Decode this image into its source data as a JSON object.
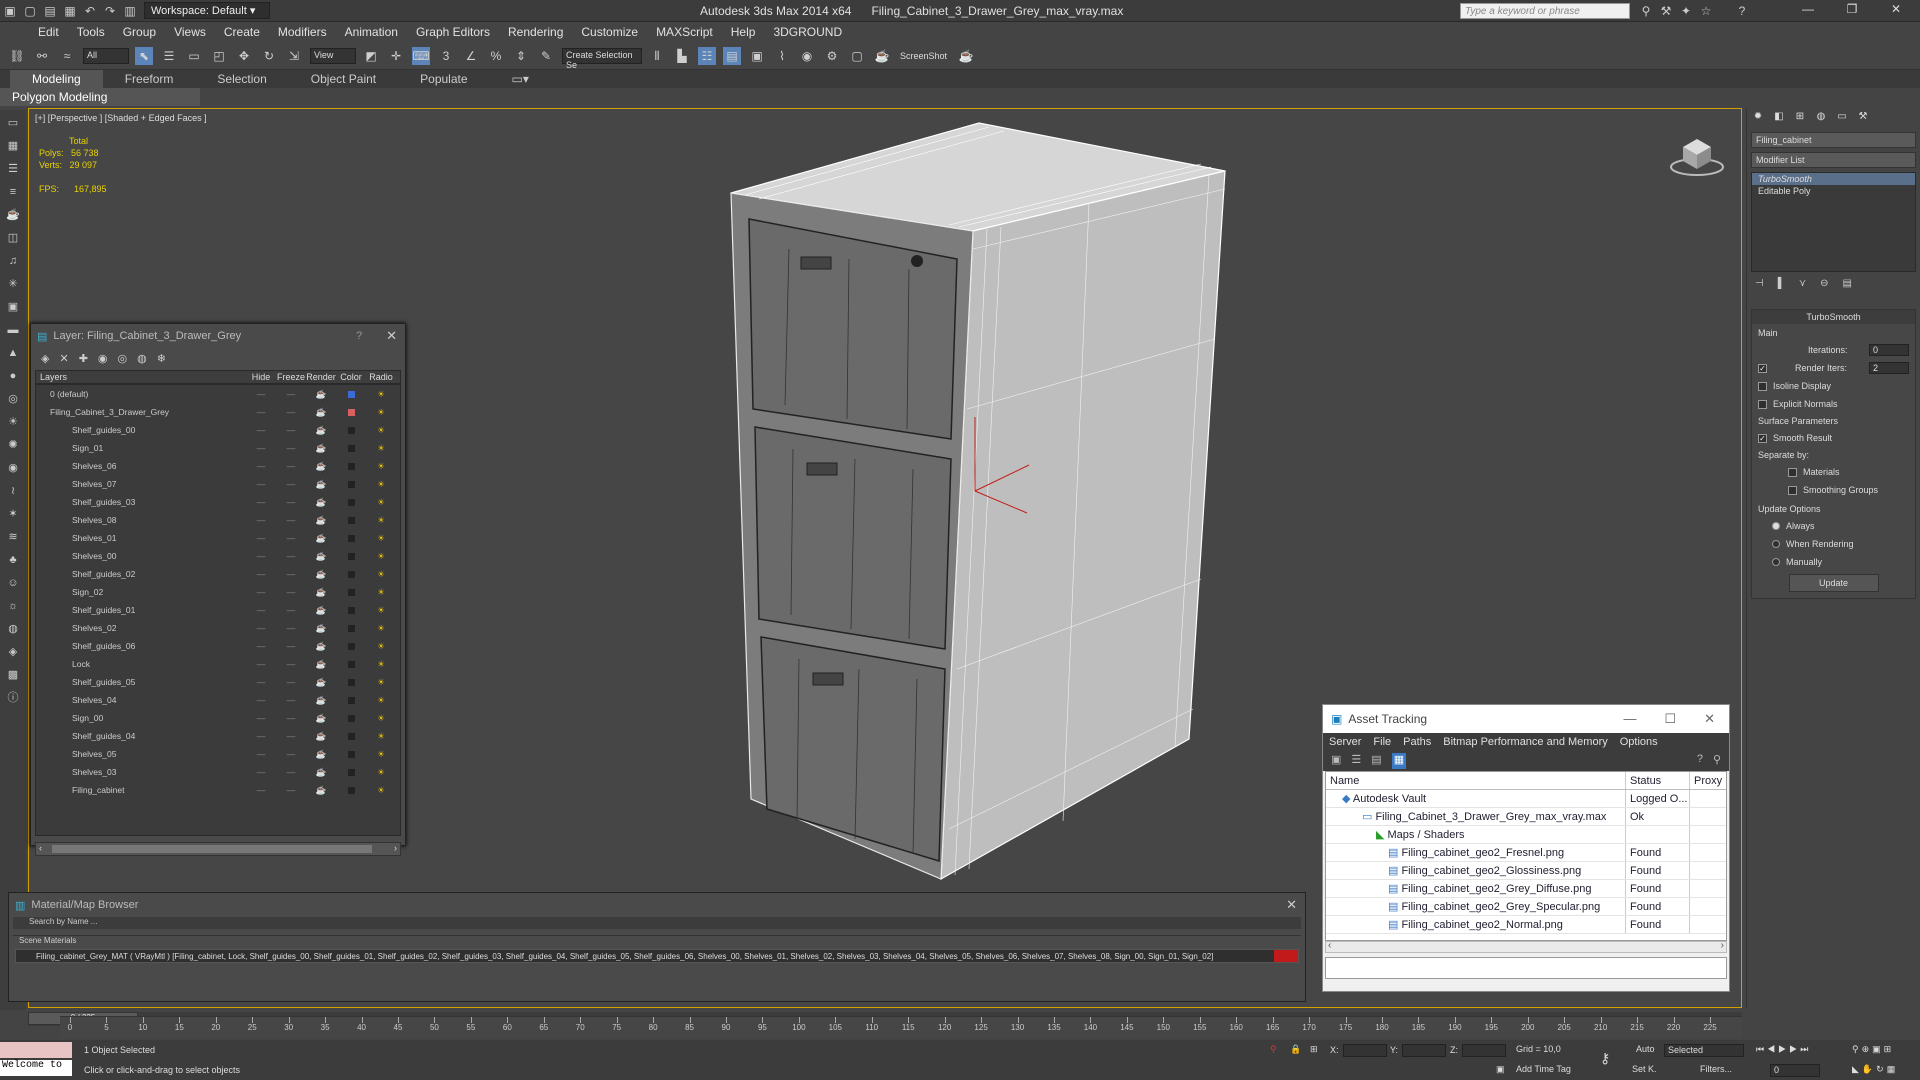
{
  "titlebar": {
    "workspace": "Workspace: Default",
    "app": "Autodesk 3ds Max  2014 x64",
    "file": "Filing_Cabinet_3_Drawer_Grey_max_vray.max",
    "search_placeholder": "Type a keyword or phrase"
  },
  "menu": [
    "Edit",
    "Tools",
    "Group",
    "Views",
    "Create",
    "Modifiers",
    "Animation",
    "Graph Editors",
    "Rendering",
    "Customize",
    "MAXScript",
    "Help",
    "3DGROUND"
  ],
  "toolbar": {
    "filter": "All",
    "view": "View",
    "selection_set": "Create Selection Se",
    "screenshot": "ScreenShot"
  },
  "ribbon": {
    "tabs": [
      "Modeling",
      "Freeform",
      "Selection",
      "Object Paint",
      "Populate"
    ],
    "sub": "Polygon Modeling"
  },
  "viewport": {
    "label": "[+] [Perspective ] [Shaded + Edged Faces ]",
    "stats": {
      "total": "Total",
      "polys_label": "Polys:",
      "polys": "56 738",
      "verts_label": "Verts:",
      "verts": "29 097",
      "fps_label": "FPS:",
      "fps": "167,895"
    }
  },
  "command_panel": {
    "object_name": "Filing_cabinet",
    "modifier_list": "Modifier List",
    "stack": [
      "TurboSmooth",
      "Editable Poly"
    ],
    "turbosmooth": {
      "title": "TurboSmooth",
      "main": "Main",
      "iterations_label": "Iterations:",
      "iterations": "0",
      "render_iters_label": "Render Iters:",
      "render_iters": "2",
      "isoline": "Isoline Display",
      "explicit": "Explicit Normals",
      "surface": "Surface Parameters",
      "smooth_result": "Smooth Result",
      "separate_by": "Separate by:",
      "materials": "Materials",
      "smoothing_groups": "Smoothing Groups",
      "update_options": "Update Options",
      "always": "Always",
      "when_rendering": "When Rendering",
      "manually": "Manually",
      "update": "Update"
    }
  },
  "layer_window": {
    "title": "Layer: Filing_Cabinet_3_Drawer_Grey",
    "columns": [
      "Layers",
      "Hide",
      "Freeze",
      "Render",
      "Color",
      "Radio"
    ],
    "rows": [
      {
        "name": "0 (default)",
        "type": "root"
      },
      {
        "name": "Filing_Cabinet_3_Drawer_Grey",
        "type": "root"
      },
      {
        "name": "Shelf_guides_00",
        "type": "sub"
      },
      {
        "name": "Sign_01",
        "type": "sub"
      },
      {
        "name": "Shelves_06",
        "type": "sub"
      },
      {
        "name": "Shelves_07",
        "type": "sub"
      },
      {
        "name": "Shelf_guides_03",
        "type": "sub"
      },
      {
        "name": "Shelves_08",
        "type": "sub"
      },
      {
        "name": "Shelves_01",
        "type": "sub"
      },
      {
        "name": "Shelves_00",
        "type": "sub"
      },
      {
        "name": "Shelf_guides_02",
        "type": "sub"
      },
      {
        "name": "Sign_02",
        "type": "sub"
      },
      {
        "name": "Shelf_guides_01",
        "type": "sub"
      },
      {
        "name": "Shelves_02",
        "type": "sub"
      },
      {
        "name": "Shelf_guides_06",
        "type": "sub"
      },
      {
        "name": "Lock",
        "type": "sub"
      },
      {
        "name": "Shelf_guides_05",
        "type": "sub"
      },
      {
        "name": "Shelves_04",
        "type": "sub"
      },
      {
        "name": "Sign_00",
        "type": "sub"
      },
      {
        "name": "Shelf_guides_04",
        "type": "sub"
      },
      {
        "name": "Shelves_05",
        "type": "sub"
      },
      {
        "name": "Shelves_03",
        "type": "sub"
      },
      {
        "name": "Filing_cabinet",
        "type": "sub"
      }
    ]
  },
  "material_browser": {
    "title": "Material/Map Browser",
    "search": "Search by Name ...",
    "section": "Scene Materials",
    "material": "Filing_cabinet_Grey_MAT ( VRayMtl ) [Filing_cabinet, Lock, Shelf_guides_00, Shelf_guides_01, Shelf_guides_02, Shelf_guides_03, Shelf_guides_04, Shelf_guides_05, Shelf_guides_06, Shelves_00, Shelves_01, Shelves_02, Shelves_03, Shelves_04, Shelves_05, Shelves_06, Shelves_07, Shelves_08, Sign_00, Sign_01, Sign_02]"
  },
  "asset_tracking": {
    "title": "Asset Tracking",
    "menu": [
      "Server",
      "File",
      "Paths",
      "Bitmap Performance and Memory",
      "Options"
    ],
    "columns": [
      "Name",
      "Status",
      "Proxy"
    ],
    "rows": [
      {
        "name": "Autodesk Vault",
        "status": "Logged O..."
      },
      {
        "name": "Filing_Cabinet_3_Drawer_Grey_max_vray.max",
        "status": "Ok"
      },
      {
        "name": "Maps / Shaders",
        "status": ""
      },
      {
        "name": "Filing_cabinet_geo2_Fresnel.png",
        "status": "Found"
      },
      {
        "name": "Filing_cabinet_geo2_Glossiness.png",
        "status": "Found"
      },
      {
        "name": "Filing_cabinet_geo2_Grey_Diffuse.png",
        "status": "Found"
      },
      {
        "name": "Filing_cabinet_geo2_Grey_Specular.png",
        "status": "Found"
      },
      {
        "name": "Filing_cabinet_geo2_Normal.png",
        "status": "Found"
      }
    ]
  },
  "timeline": {
    "frame": "0 / 225",
    "ticks": [
      "0",
      "5",
      "10",
      "15",
      "20",
      "25",
      "30",
      "35",
      "40",
      "45",
      "50",
      "55",
      "60",
      "65",
      "70",
      "75",
      "80",
      "85",
      "90",
      "95",
      "100",
      "105",
      "110",
      "115",
      "120",
      "125",
      "130",
      "135",
      "140",
      "145",
      "150",
      "155",
      "160",
      "165",
      "170",
      "175",
      "180",
      "185",
      "190",
      "195",
      "200",
      "205",
      "210",
      "215",
      "220",
      "225"
    ]
  },
  "status": {
    "welcome": "Welcome to",
    "selected": "1 Object Selected",
    "hint": "Click or click-and-drag to select objects",
    "x": "X:",
    "y": "Y:",
    "z": "Z:",
    "grid": "Grid = 10,0",
    "add_time_tag": "Add Time Tag",
    "auto": "Auto",
    "set_key": "Set K.",
    "key_mode": "Selected",
    "filters": "Filters...",
    "frame_field": "0"
  }
}
